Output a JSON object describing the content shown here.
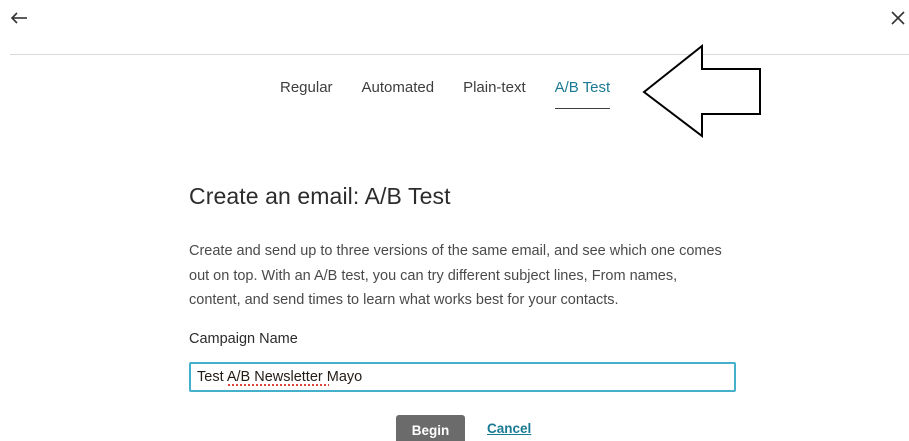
{
  "header": {
    "back_icon": "arrow-left-icon",
    "close_icon": "close-icon"
  },
  "tabs": [
    {
      "label": "Regular",
      "active": false
    },
    {
      "label": "Automated",
      "active": false
    },
    {
      "label": "Plain-text",
      "active": false
    },
    {
      "label": "A/B Test",
      "active": true
    }
  ],
  "main": {
    "heading": "Create an email: A/B Test",
    "description": "Create and send up to three versions of the same email, and see which one comes out on top. With an A/B test, you can try different subject lines, From names, content, and send times to learn what works best for your contacts.",
    "campaign_name_label": "Campaign Name",
    "campaign_name_value": "Test A/B Newsletter Mayo",
    "begin_label": "Begin",
    "cancel_label": "Cancel"
  },
  "colors": {
    "accent": "#1b7a93",
    "input_border": "#44b0c9",
    "button_bg": "#6b6b6b"
  }
}
